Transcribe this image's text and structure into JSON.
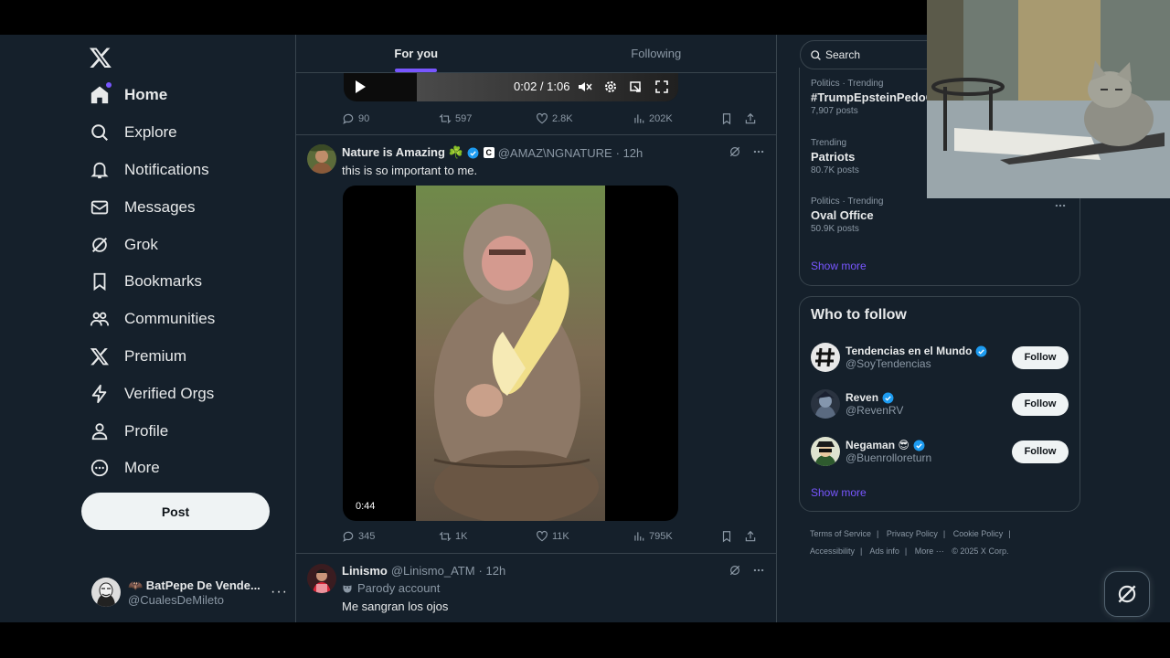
{
  "nav": {
    "items": [
      {
        "label": "Home",
        "icon": "home-icon",
        "active": true
      },
      {
        "label": "Explore",
        "icon": "search-icon"
      },
      {
        "label": "Notifications",
        "icon": "bell-icon"
      },
      {
        "label": "Messages",
        "icon": "envelope-icon"
      },
      {
        "label": "Grok",
        "icon": "grok-icon"
      },
      {
        "label": "Bookmarks",
        "icon": "bookmark-icon"
      },
      {
        "label": "Communities",
        "icon": "people-icon"
      },
      {
        "label": "Premium",
        "icon": "x-logo-icon"
      },
      {
        "label": "Verified Orgs",
        "icon": "lightning-icon"
      },
      {
        "label": "Profile",
        "icon": "person-icon"
      },
      {
        "label": "More",
        "icon": "more-circle-icon"
      }
    ],
    "post_label": "Post"
  },
  "account": {
    "name": "🦇 BatPepe De Vende...",
    "handle": "@CualesDeMileto",
    "more": "···"
  },
  "tabs": {
    "for_you": "For you",
    "following": "Following"
  },
  "player": {
    "time": "0:02 / 1:06"
  },
  "tweet1_actions": {
    "replies": "90",
    "reposts": "597",
    "likes": "2.8K",
    "views": "202K"
  },
  "tweet2": {
    "name": "Nature is Amazing ☘️",
    "handle": "@AMAZ\\NGNATURE",
    "time": "· 12h",
    "text": "this is so important to me.",
    "video_duration": "0:44",
    "replies": "345",
    "reposts": "1K",
    "likes": "11K",
    "views": "795K"
  },
  "tweet3": {
    "name": "Linismo",
    "handle": "@Linismo_ATM",
    "time": "· 12h",
    "label": "Parody account",
    "text": "Me sangran los ojos"
  },
  "search": {
    "placeholder": "Search"
  },
  "trends": [
    {
      "category": "Politics · Trending",
      "name": "#TrumpEpsteinPedoC",
      "count": "7,907 posts"
    },
    {
      "category": "Trending",
      "name": "Patriots",
      "count": "80.7K posts"
    },
    {
      "category": "Politics · Trending",
      "name": "Oval Office",
      "count": "50.9K posts"
    }
  ],
  "trends_show_more": "Show more",
  "who_to_follow": {
    "title": "Who to follow",
    "users": [
      {
        "name": "Tendencias en el Mundo",
        "handle": "@SoyTendencias",
        "button": "Follow"
      },
      {
        "name": "Reven",
        "handle": "@RevenRV",
        "button": "Follow"
      },
      {
        "name": "Negaman 😎",
        "handle": "@Buenrolloreturn",
        "button": "Follow"
      }
    ],
    "show_more": "Show more"
  },
  "footer": {
    "terms": "Terms of Service",
    "privacy": "Privacy Policy",
    "cookie": "Cookie Policy",
    "accessibility": "Accessibility",
    "ads": "Ads info",
    "more": "More ···",
    "copyright": "© 2025 X Corp."
  },
  "colors": {
    "background": "#15202b",
    "accent": "#7856ff",
    "verified": "#1d9bf0",
    "border": "#38444d"
  }
}
